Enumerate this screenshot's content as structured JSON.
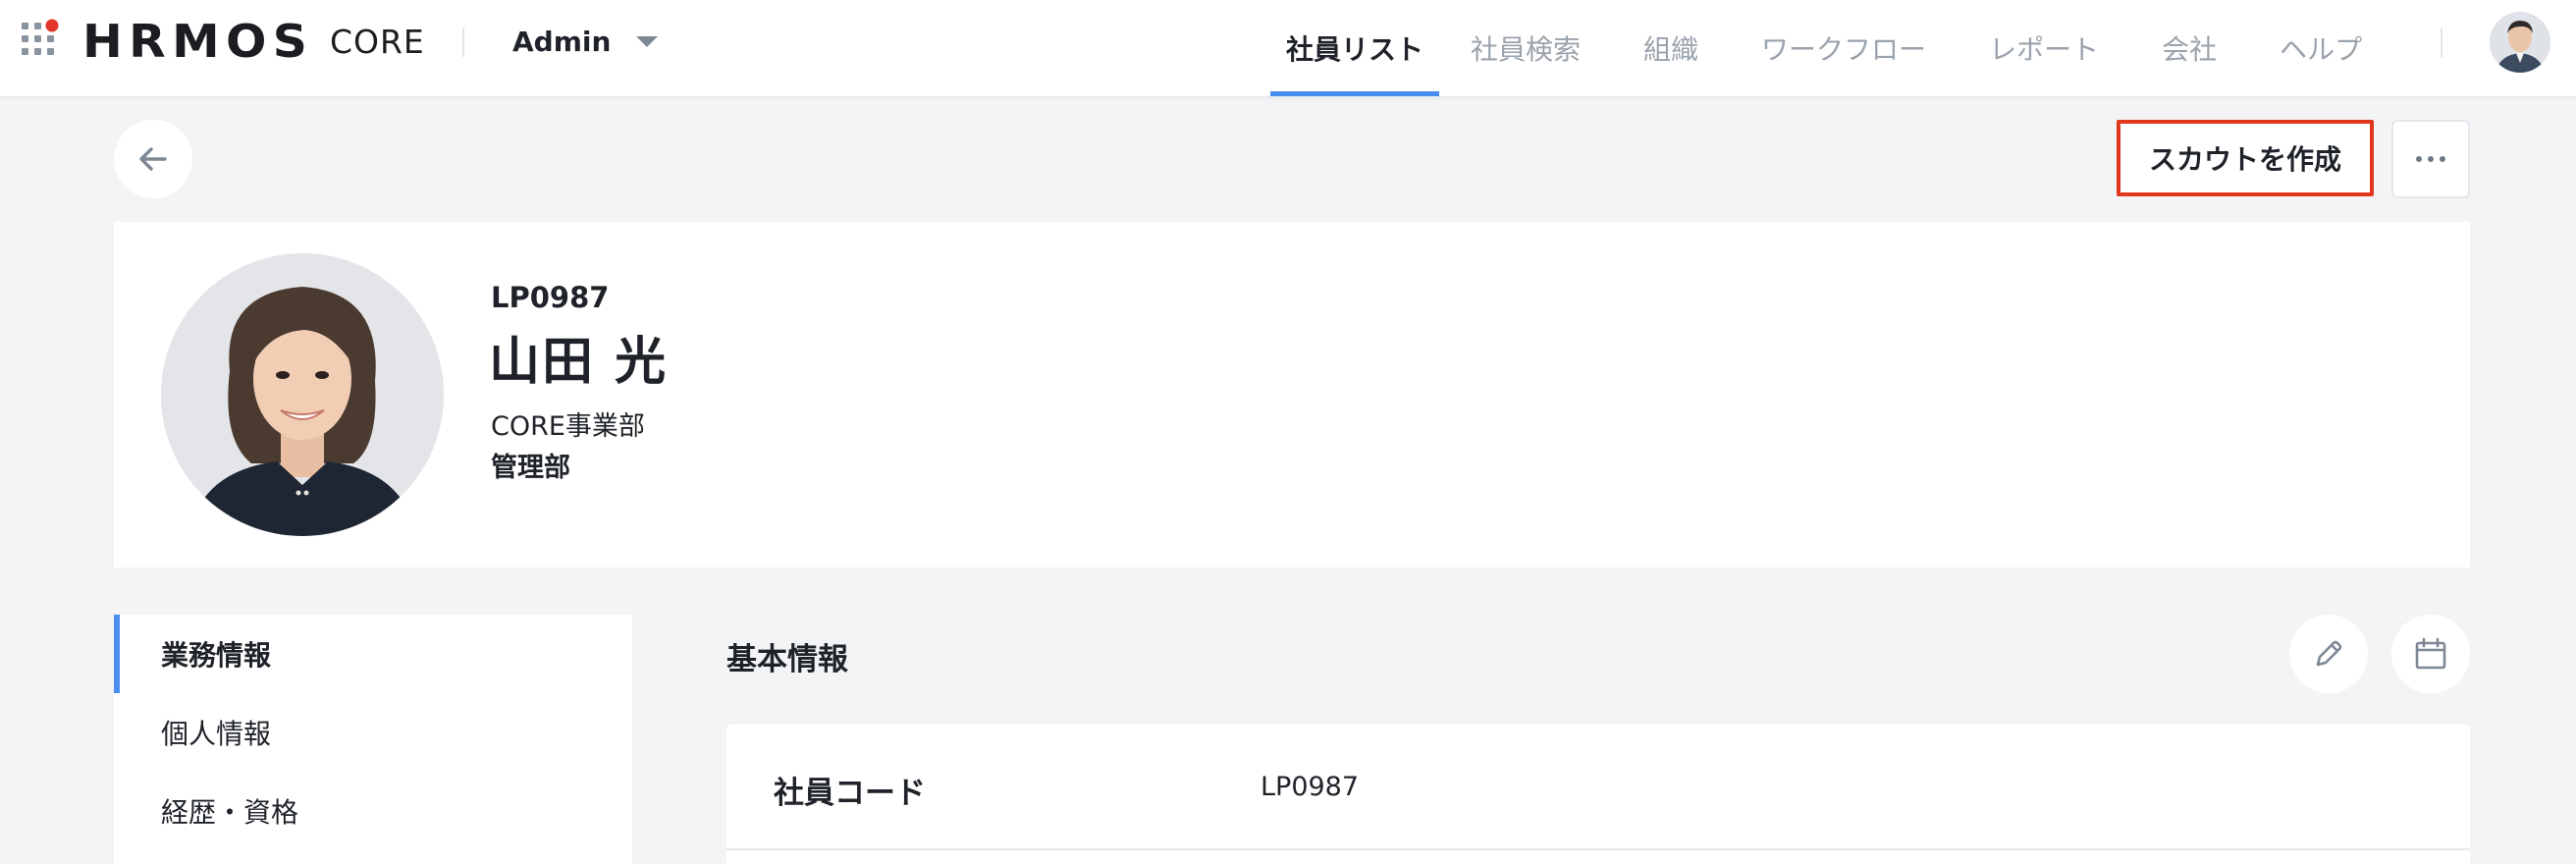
{
  "header": {
    "apps_icon": "grid-apps-icon",
    "logo_text": "HRMOS",
    "logo_product": "CORE",
    "role": "Admin",
    "nav": [
      {
        "label": "社員リスト",
        "active": true
      },
      {
        "label": "社員検索",
        "active": false
      },
      {
        "label": "組織",
        "active": false
      },
      {
        "label": "ワークフロー",
        "active": false
      },
      {
        "label": "レポート",
        "active": false
      },
      {
        "label": "会社",
        "active": false
      },
      {
        "label": "ヘルプ",
        "active": false
      }
    ]
  },
  "actions": {
    "back_icon": "arrow-left-icon",
    "scout_label": "スカウトを作成",
    "more_icon": "ellipsis-icon"
  },
  "profile": {
    "employee_code": "LP0987",
    "name": "山田 光",
    "division": "CORE事業部",
    "department": "管理部"
  },
  "side_menu": {
    "items": [
      {
        "label": "業務情報",
        "active": true
      },
      {
        "label": "個人情報",
        "active": false
      },
      {
        "label": "経歴・資格",
        "active": false
      }
    ]
  },
  "main": {
    "section_title": "基本情報",
    "edit_icon": "pencil-icon",
    "history_icon": "calendar-icon",
    "fields": [
      {
        "label": "社員コード",
        "value": "LP0987"
      }
    ]
  },
  "colors": {
    "accent": "#4a8ff0",
    "highlight_border": "#e0371d",
    "logo_dot": "#e3372b",
    "background": "#f3f4f6"
  }
}
